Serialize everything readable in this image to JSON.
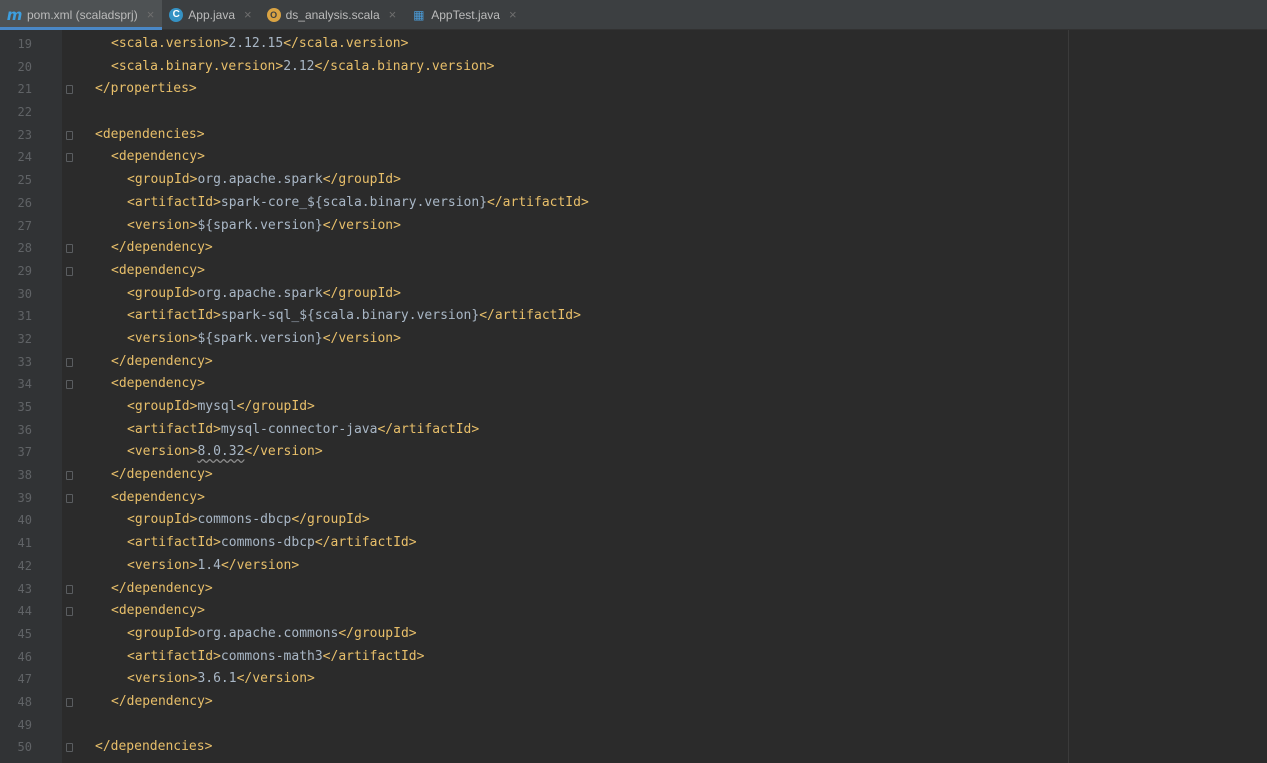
{
  "tabs": [
    {
      "label": "pom.xml (scaladsprj)",
      "icon": "maven-m-icon",
      "glyph": "m",
      "active": true
    },
    {
      "label": "App.java",
      "icon": "java-class-icon",
      "glyph": "C",
      "active": false
    },
    {
      "label": "ds_analysis.scala",
      "icon": "scala-object-icon",
      "glyph": "O",
      "active": false
    },
    {
      "label": "AppTest.java",
      "icon": "test-class-icon",
      "glyph": "▦",
      "active": false
    }
  ],
  "close_glyph": "×",
  "editor": {
    "lines": [
      {
        "n": "19",
        "indent": 2,
        "open": "<scala.version>",
        "text": "2.12.15",
        "close": "</scala.version>",
        "fold": false
      },
      {
        "n": "20",
        "indent": 2,
        "open": "<scala.binary.version>",
        "text": "2.12",
        "close": "</scala.binary.version>",
        "fold": false
      },
      {
        "n": "21",
        "indent": 0,
        "open": "</properties>",
        "text": "",
        "close": "",
        "fold": true
      },
      {
        "n": "22",
        "indent": 0,
        "open": "",
        "text": "",
        "close": "",
        "fold": false
      },
      {
        "n": "23",
        "indent": 0,
        "open": "<dependencies>",
        "text": "",
        "close": "",
        "fold": true
      },
      {
        "n": "24",
        "indent": 2,
        "open": "<dependency>",
        "text": "",
        "close": "",
        "fold": true
      },
      {
        "n": "25",
        "indent": 4,
        "open": "<groupId>",
        "text": "org.apache.spark",
        "close": "</groupId>",
        "fold": false
      },
      {
        "n": "26",
        "indent": 4,
        "open": "<artifactId>",
        "text": "spark-core_${scala.binary.version}",
        "close": "</artifactId>",
        "fold": false
      },
      {
        "n": "27",
        "indent": 4,
        "open": "<version>",
        "text": "${spark.version}",
        "close": "</version>",
        "fold": false
      },
      {
        "n": "28",
        "indent": 2,
        "open": "</dependency>",
        "text": "",
        "close": "",
        "fold": true
      },
      {
        "n": "29",
        "indent": 2,
        "open": "<dependency>",
        "text": "",
        "close": "",
        "fold": true
      },
      {
        "n": "30",
        "indent": 4,
        "open": "<groupId>",
        "text": "org.apache.spark",
        "close": "</groupId>",
        "fold": false
      },
      {
        "n": "31",
        "indent": 4,
        "open": "<artifactId>",
        "text": "spark-sql_${scala.binary.version}",
        "close": "</artifactId>",
        "fold": false
      },
      {
        "n": "32",
        "indent": 4,
        "open": "<version>",
        "text": "${spark.version}",
        "close": "</version>",
        "fold": false
      },
      {
        "n": "33",
        "indent": 2,
        "open": "</dependency>",
        "text": "",
        "close": "",
        "fold": true
      },
      {
        "n": "34",
        "indent": 2,
        "open": "<dependency>",
        "text": "",
        "close": "",
        "fold": true
      },
      {
        "n": "35",
        "indent": 4,
        "open": "<groupId>",
        "text": "mysql",
        "close": "</groupId>",
        "fold": false
      },
      {
        "n": "36",
        "indent": 4,
        "open": "<artifactId>",
        "text": "mysql-connector-java",
        "close": "</artifactId>",
        "fold": false
      },
      {
        "n": "37",
        "indent": 4,
        "open": "<version>",
        "text": "8.0.32",
        "close": "</version>",
        "fold": false,
        "warn": true
      },
      {
        "n": "38",
        "indent": 2,
        "open": "</dependency>",
        "text": "",
        "close": "",
        "fold": true
      },
      {
        "n": "39",
        "indent": 2,
        "open": "<dependency>",
        "text": "",
        "close": "",
        "fold": true
      },
      {
        "n": "40",
        "indent": 4,
        "open": "<groupId>",
        "text": "commons-dbcp",
        "close": "</groupId>",
        "fold": false
      },
      {
        "n": "41",
        "indent": 4,
        "open": "<artifactId>",
        "text": "commons-dbcp",
        "close": "</artifactId>",
        "fold": false
      },
      {
        "n": "42",
        "indent": 4,
        "open": "<version>",
        "text": "1.4",
        "close": "</version>",
        "fold": false
      },
      {
        "n": "43",
        "indent": 2,
        "open": "</dependency>",
        "text": "",
        "close": "",
        "fold": true
      },
      {
        "n": "44",
        "indent": 2,
        "open": "<dependency>",
        "text": "",
        "close": "",
        "fold": true
      },
      {
        "n": "45",
        "indent": 4,
        "open": "<groupId>",
        "text": "org.apache.commons",
        "close": "</groupId>",
        "fold": false
      },
      {
        "n": "46",
        "indent": 4,
        "open": "<artifactId>",
        "text": "commons-math3",
        "close": "</artifactId>",
        "fold": false
      },
      {
        "n": "47",
        "indent": 4,
        "open": "<version>",
        "text": "3.6.1",
        "close": "</version>",
        "fold": false
      },
      {
        "n": "48",
        "indent": 2,
        "open": "</dependency>",
        "text": "",
        "close": "",
        "fold": true
      },
      {
        "n": "49",
        "indent": 0,
        "open": "",
        "text": "",
        "close": "",
        "fold": false
      },
      {
        "n": "50",
        "indent": 0,
        "open": "</dependencies>",
        "text": "",
        "close": "",
        "fold": true
      }
    ]
  },
  "colors": {
    "background": "#2b2b2b",
    "tag": "#e8bf6a",
    "text": "#a9b7c6",
    "line_number": "#606366",
    "active_tab_underline": "#4a88c7"
  }
}
